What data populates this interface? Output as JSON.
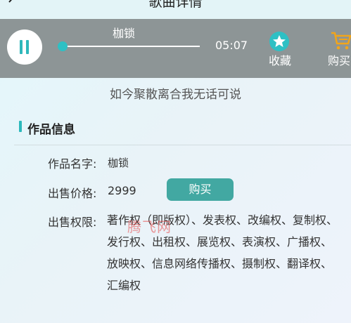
{
  "nav": {
    "title": "歌曲详情"
  },
  "player": {
    "song_name": "枷锁",
    "duration": "05:07",
    "progress": 0,
    "favorite_label": "收藏",
    "buy_label": "购买"
  },
  "lyric": "如今聚散离合我无话可说",
  "section": {
    "title": "作品信息"
  },
  "work": {
    "name_label": "作品名字:",
    "name_value": "枷锁",
    "price_label": "出售价格:",
    "price_value": "2999",
    "buy_button": "购买",
    "rights_label": "出售权限:",
    "rights_value": "著作权（即版权）、发表权、改编权、复制权、发行权、出租权、展览权、表演权、广播权、放映权、信息网络传播权、摄制权、翻译权、汇编权"
  },
  "watermark": "腾飞网",
  "colors": {
    "accent": "#2ec0c4",
    "button": "#42a8a2",
    "player_bg": "#8d9596",
    "cart": "#f2a51a"
  },
  "icons": [
    "back-icon",
    "pause-icon",
    "star-badge-icon",
    "cart-icon"
  ]
}
